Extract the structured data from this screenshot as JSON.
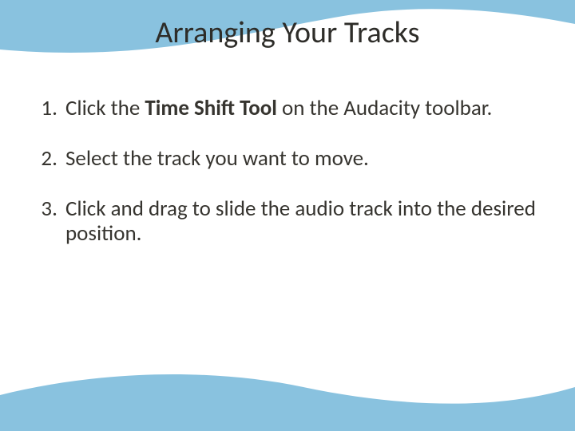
{
  "title": "Arranging Your Tracks",
  "steps": {
    "s1_pre": "Click the ",
    "s1_bold": "Time Shift Tool",
    "s1_post": " on the Audacity toolbar.",
    "s2": "Select the track you want to move.",
    "s3": "Click and drag to slide the audio track into the desired position."
  },
  "colors": {
    "wave": "#89c2df"
  }
}
